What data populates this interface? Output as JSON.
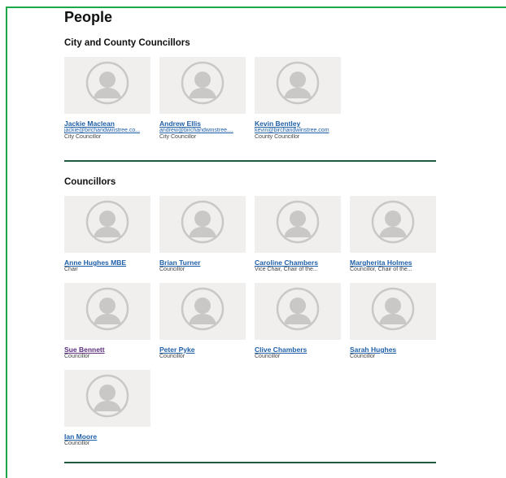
{
  "page": {
    "title": "People"
  },
  "sections": [
    {
      "title": "City and County Councillors",
      "people": [
        {
          "name": "Jackie Maclean",
          "email": "jackie@birchandwinstree.co...",
          "role": "City Councillor"
        },
        {
          "name": "Andrew Ellis",
          "email": "andrew@birchandwinstree....",
          "role": "City Councillor"
        },
        {
          "name": "Kevin Bentley",
          "email": "kevin@birchandwinstree.com",
          "role": "County Councillor"
        }
      ]
    },
    {
      "title": "Councillors",
      "people": [
        {
          "name": "Anne Hughes MBE",
          "role": "Chair"
        },
        {
          "name": "Brian Turner",
          "role": "Councillor"
        },
        {
          "name": "Caroline Chambers",
          "role": "Vice Chair, Chair of the..."
        },
        {
          "name": "Margherita Holmes",
          "role": "Councillor, Chair of the..."
        },
        {
          "name": "Sue Bennett",
          "role": "Councillor"
        },
        {
          "name": "Peter Pyke",
          "role": "Councillor"
        },
        {
          "name": "Clive Chambers",
          "role": "Councillor"
        },
        {
          "name": "Sarah Hughes",
          "role": "Councillor"
        },
        {
          "name": "Ian Moore",
          "role": "Councillor"
        }
      ]
    }
  ],
  "colors": {
    "link": "#1f5fa8",
    "visited_link": "#5b2e7e",
    "rule": "#1e5a3c",
    "frame": "#1aa84a"
  }
}
